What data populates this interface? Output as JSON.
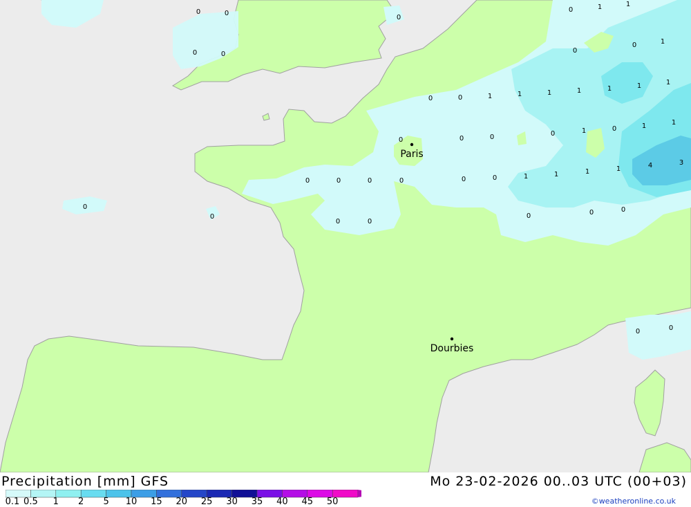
{
  "header": {
    "title": "Precipitation [mm] GFS",
    "datetime": "Mo 23-02-2026 00..03 UTC (00+03)",
    "credit": "©weatheronline.co.uk"
  },
  "legend": {
    "labels": [
      "0.1",
      "0.5",
      "1",
      "2",
      "5",
      "10",
      "15",
      "20",
      "25",
      "30",
      "35",
      "40",
      "45",
      "50"
    ],
    "colors": [
      "#d6fafa",
      "#b4f5f5",
      "#8ff0f0",
      "#68dcf0",
      "#4cc3ea",
      "#3c9ee6",
      "#3270dc",
      "#2446c8",
      "#1a28b4",
      "#100f96",
      "#7a10e6",
      "#b40ee6",
      "#dc0ae6",
      "#f00ac8",
      "#b40ab4"
    ]
  },
  "map": {
    "colors": {
      "sea": "#ececec",
      "land": "#ccffaa",
      "precip_light": "#d2fafa",
      "precip_mid": "#a8f3f3",
      "precip_high": "#7ee8ee",
      "precip_peak": "#5ccbe6",
      "coast": "#a0a0a0"
    },
    "cities": [
      {
        "name": "Paris"
      },
      {
        "name": "Dourbies"
      }
    ],
    "values": [
      "0",
      "0",
      "0",
      "0",
      "0",
      "0",
      "1",
      "1",
      "0",
      "0",
      "0",
      "1",
      "1",
      "1",
      "1",
      "1",
      "1",
      "1",
      "1",
      "0",
      "0",
      "0",
      "0",
      "1",
      "0",
      "1",
      "1",
      "0",
      "0",
      "0",
      "0",
      "0",
      "0",
      "0",
      "0",
      "0",
      "1",
      "1",
      "0",
      "1",
      "1",
      "4",
      "3",
      "0",
      "0",
      "0",
      "0",
      "0",
      "0",
      "0",
      "0",
      "0",
      "0",
      "0"
    ]
  }
}
